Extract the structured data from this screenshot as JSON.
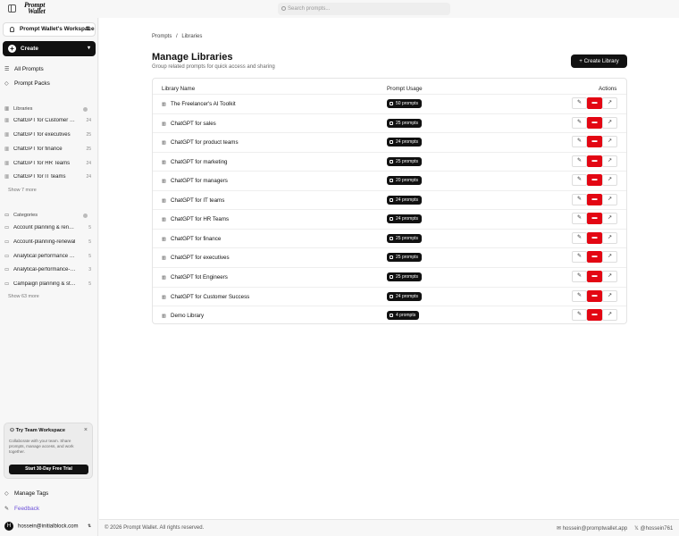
{
  "topbar": {
    "logo_line1": "Prompt",
    "logo_line2": "Wallet",
    "search_placeholder": "Search prompts..."
  },
  "sidebar": {
    "workspace": "Prompt Wallet's Workspace",
    "create_label": "Create",
    "nav": [
      {
        "label": "All Prompts",
        "icon": "list-icon"
      },
      {
        "label": "Prompt Packs",
        "icon": "tag-icon"
      }
    ],
    "libraries_title": "Libraries",
    "libraries": [
      {
        "label": "ChatGPT for Customer Success",
        "count": "24"
      },
      {
        "label": "ChatGPT for executives",
        "count": "25"
      },
      {
        "label": "ChatGPT for finance",
        "count": "25"
      },
      {
        "label": "ChatGPT for HR Teams",
        "count": "24"
      },
      {
        "label": "ChatGPT for IT teams",
        "count": "24"
      }
    ],
    "libraries_more": "Show 7 more",
    "categories_title": "Categories",
    "categories": [
      {
        "label": "Account planning & renewal",
        "count": "5"
      },
      {
        "label": "Account-planning-renewal",
        "count": "5"
      },
      {
        "label": "Analytical performance & metrics",
        "count": "5"
      },
      {
        "label": "Analytical-performance-metrics",
        "count": "3"
      },
      {
        "label": "Campaign planning & strategy",
        "count": "5"
      }
    ],
    "categories_more": "Show 63 more",
    "try": {
      "title": "Try Team Workspace",
      "text": "Collaborate with your team. Share prompts, manage access, and work together.",
      "button": "Start 30-Day Free Trial"
    },
    "manage_tags": "Manage Tags",
    "feedback": "Feedback",
    "user_initial": "H",
    "user_email": "hossein@initialblock.com"
  },
  "main": {
    "breadcrumb": [
      "Prompts",
      "Libraries"
    ],
    "breadcrumb_sep": "/",
    "title": "Manage Libraries",
    "subtitle": "Group related prompts for quick access and sharing",
    "create_button": "Create Library",
    "columns": {
      "name": "Library Name",
      "usage": "Prompt Usage",
      "actions": "Actions"
    },
    "rows": [
      {
        "name": "The Freelancer's AI Toolkit",
        "usage": "50 prompts"
      },
      {
        "name": "ChatGPT for sales",
        "usage": "25 prompts"
      },
      {
        "name": "ChatGPT for product teams",
        "usage": "24 prompts"
      },
      {
        "name": "ChatGPT for marketing",
        "usage": "25 prompts"
      },
      {
        "name": "ChatGPT for managers",
        "usage": "20 prompts"
      },
      {
        "name": "ChatGPT for IT teams",
        "usage": "24 prompts"
      },
      {
        "name": "ChatGPT for HR Teams",
        "usage": "24 prompts"
      },
      {
        "name": "ChatGPT for finance",
        "usage": "25 prompts"
      },
      {
        "name": "ChatGPT for executives",
        "usage": "25 prompts"
      },
      {
        "name": "ChatGPT fot Engineers",
        "usage": "25 prompts"
      },
      {
        "name": "ChatGPT for Customer Success",
        "usage": "24 prompts"
      },
      {
        "name": "Demo Library",
        "usage": "4 prompts"
      }
    ]
  },
  "footer": {
    "copyright": "© 2026 Prompt Wallet. All rights reserved.",
    "email": "hossein@promptwallet.app",
    "twitter": "@hossein761"
  },
  "colors": {
    "accent": "#111111",
    "delete": "#e30613",
    "feedback": "#6b4fd8"
  }
}
